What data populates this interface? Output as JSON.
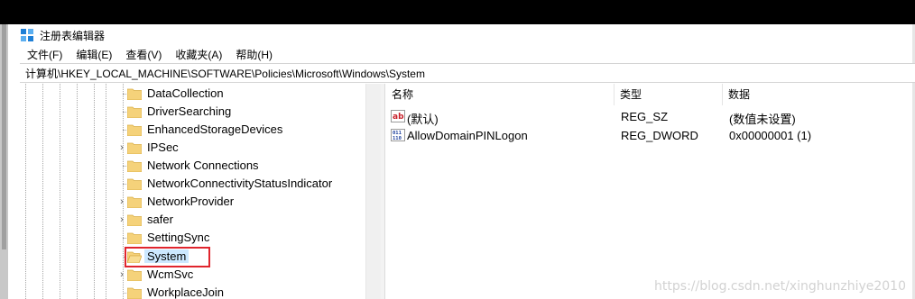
{
  "window": {
    "title": "注册表编辑器",
    "menu": [
      "文件(F)",
      "编辑(E)",
      "查看(V)",
      "收藏夹(A)",
      "帮助(H)"
    ]
  },
  "address": "计算机\\HKEY_LOCAL_MACHINE\\SOFTWARE\\Policies\\Microsoft\\Windows\\System",
  "tree": {
    "items": [
      {
        "label": "DataCollection",
        "expandable": false
      },
      {
        "label": "DriverSearching",
        "expandable": false
      },
      {
        "label": "EnhancedStorageDevices",
        "expandable": false
      },
      {
        "label": "IPSec",
        "expandable": true
      },
      {
        "label": "Network Connections",
        "expandable": false
      },
      {
        "label": "NetworkConnectivityStatusIndicator",
        "expandable": false
      },
      {
        "label": "NetworkProvider",
        "expandable": true
      },
      {
        "label": "safer",
        "expandable": true
      },
      {
        "label": "SettingSync",
        "expandable": false
      },
      {
        "label": "System",
        "expandable": false,
        "selected": true
      },
      {
        "label": "WcmSvc",
        "expandable": true
      },
      {
        "label": "WorkplaceJoin",
        "expandable": false
      }
    ]
  },
  "list": {
    "headers": {
      "name": "名称",
      "type": "类型",
      "data": "数据"
    },
    "rows": [
      {
        "icon": "string-value-icon",
        "name": "(默认)",
        "type": "REG_SZ",
        "data": "(数值未设置)"
      },
      {
        "icon": "binary-value-icon",
        "name": "AllowDomainPINLogon",
        "type": "REG_DWORD",
        "data": "0x00000001 (1)"
      }
    ]
  },
  "colors": {
    "selection": "#cce8ff",
    "highlight_box": "#e0252d",
    "folder": "#f5d27a"
  },
  "watermark": "https://blog.csdn.net/xinghunzhiye2010"
}
